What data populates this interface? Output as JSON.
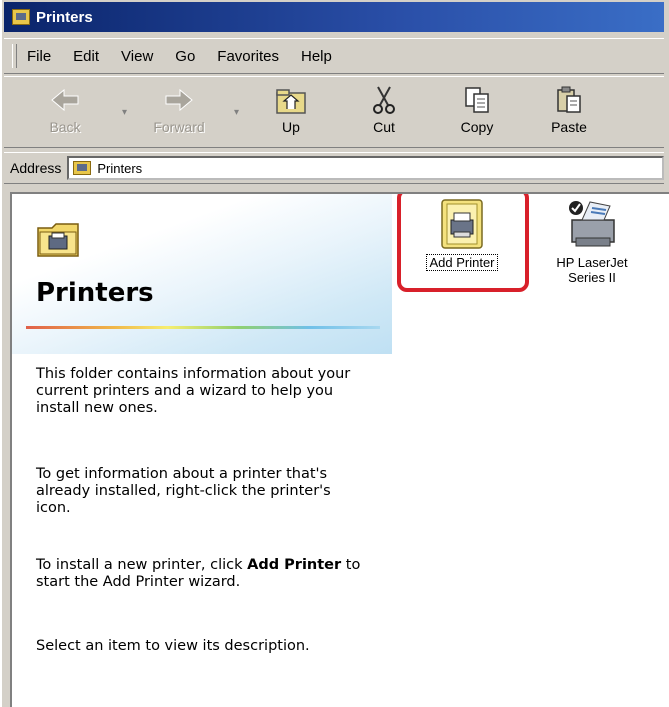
{
  "window": {
    "title": "Printers"
  },
  "menu": [
    "File",
    "Edit",
    "View",
    "Go",
    "Favorites",
    "Help"
  ],
  "toolbar": {
    "back": "Back",
    "forward": "Forward",
    "up": "Up",
    "cut": "Cut",
    "copy": "Copy",
    "paste": "Paste"
  },
  "address": {
    "label": "Address",
    "value": "Printers"
  },
  "pane": {
    "title": "Printers",
    "p1": "This folder contains information about your current printers and a wizard to help you install new ones.",
    "p2": "To get information about a printer that's already installed, right-click the printer's icon.",
    "p3_before": "To install a new printer, click ",
    "p3_bold": "Add Printer",
    "p3_after": " to start the Add Printer wizard.",
    "p4": "Select an item to view its description."
  },
  "items": [
    {
      "label": "Add Printer"
    },
    {
      "label_line1": "HP LaserJet",
      "label_line2": "Series II"
    }
  ],
  "colors": {
    "highlight": "#d8202a",
    "titlebar": "#0a246a"
  }
}
